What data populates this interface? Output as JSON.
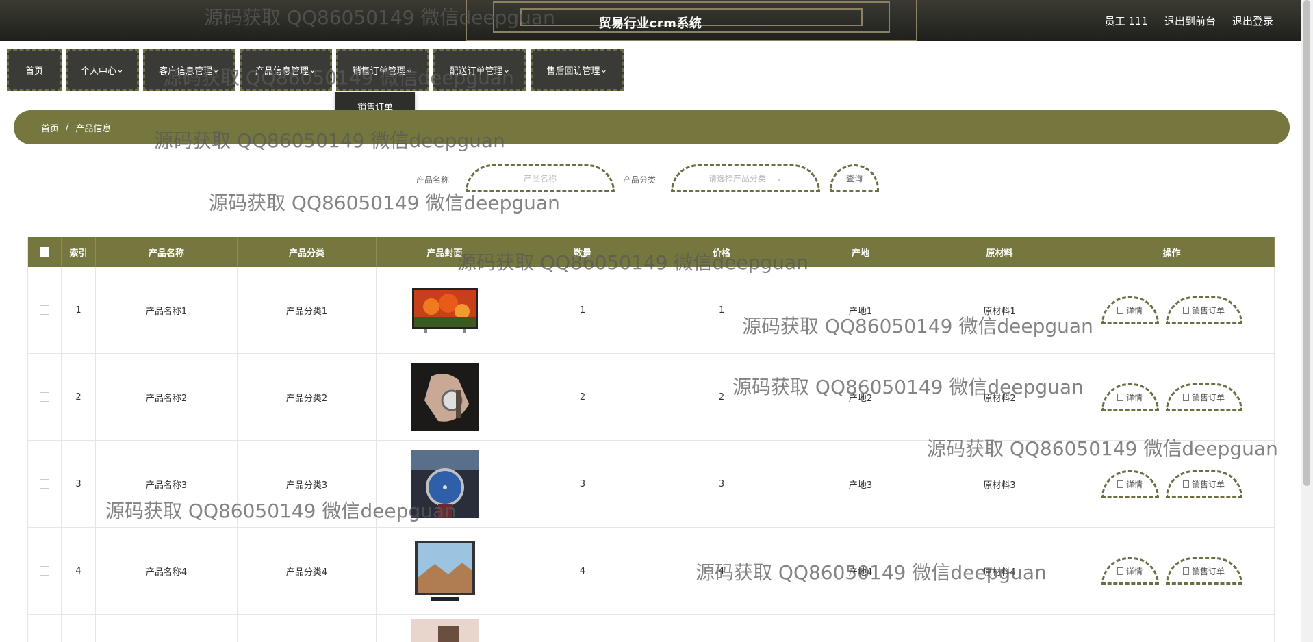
{
  "header": {
    "title": "贸易行业crm系统",
    "user": "员工 111",
    "front_link": "退出到前台",
    "logout_link": "退出登录"
  },
  "nav": [
    {
      "label": "首页"
    },
    {
      "label": "个人中心"
    },
    {
      "label": "客户信息管理"
    },
    {
      "label": "产品信息管理"
    },
    {
      "label": "销售订单管理"
    },
    {
      "label": "配送订单管理"
    },
    {
      "label": "售后回访管理"
    }
  ],
  "dropdown": {
    "item": "销售订单"
  },
  "breadcrumb": {
    "home": "首页",
    "separator": "/",
    "current": "产品信息"
  },
  "search": {
    "name_label": "产品名称",
    "name_placeholder": "产品名称",
    "category_label": "产品分类",
    "category_placeholder": "请选择产品分类",
    "query_button": "查询"
  },
  "table": {
    "headers": [
      "",
      "索引",
      "产品名称",
      "产品分类",
      "产品封面",
      "数量",
      "价格",
      "产地",
      "原材料",
      "操作"
    ],
    "rows": [
      {
        "index": "1",
        "name": "产品名称1",
        "category": "产品分类1",
        "qty": "1",
        "price": "1",
        "origin": "产地1",
        "material": "原材料1"
      },
      {
        "index": "2",
        "name": "产品名称2",
        "category": "产品分类2",
        "qty": "2",
        "price": "2",
        "origin": "产地2",
        "material": "原材料2"
      },
      {
        "index": "3",
        "name": "产品名称3",
        "category": "产品分类3",
        "qty": "3",
        "price": "3",
        "origin": "产地3",
        "material": "原材料3"
      },
      {
        "index": "4",
        "name": "产品名称4",
        "category": "产品分类4",
        "qty": "4",
        "price": "4",
        "origin": "产地4",
        "material": "原材料4"
      }
    ],
    "detail_button": "详情",
    "order_button": "销售订单"
  },
  "watermark": "源码获取 QQ86050149 微信deepguan",
  "colors": {
    "accent": "#76763f",
    "header": "#2a2b26",
    "nav": "#3a3a36"
  }
}
